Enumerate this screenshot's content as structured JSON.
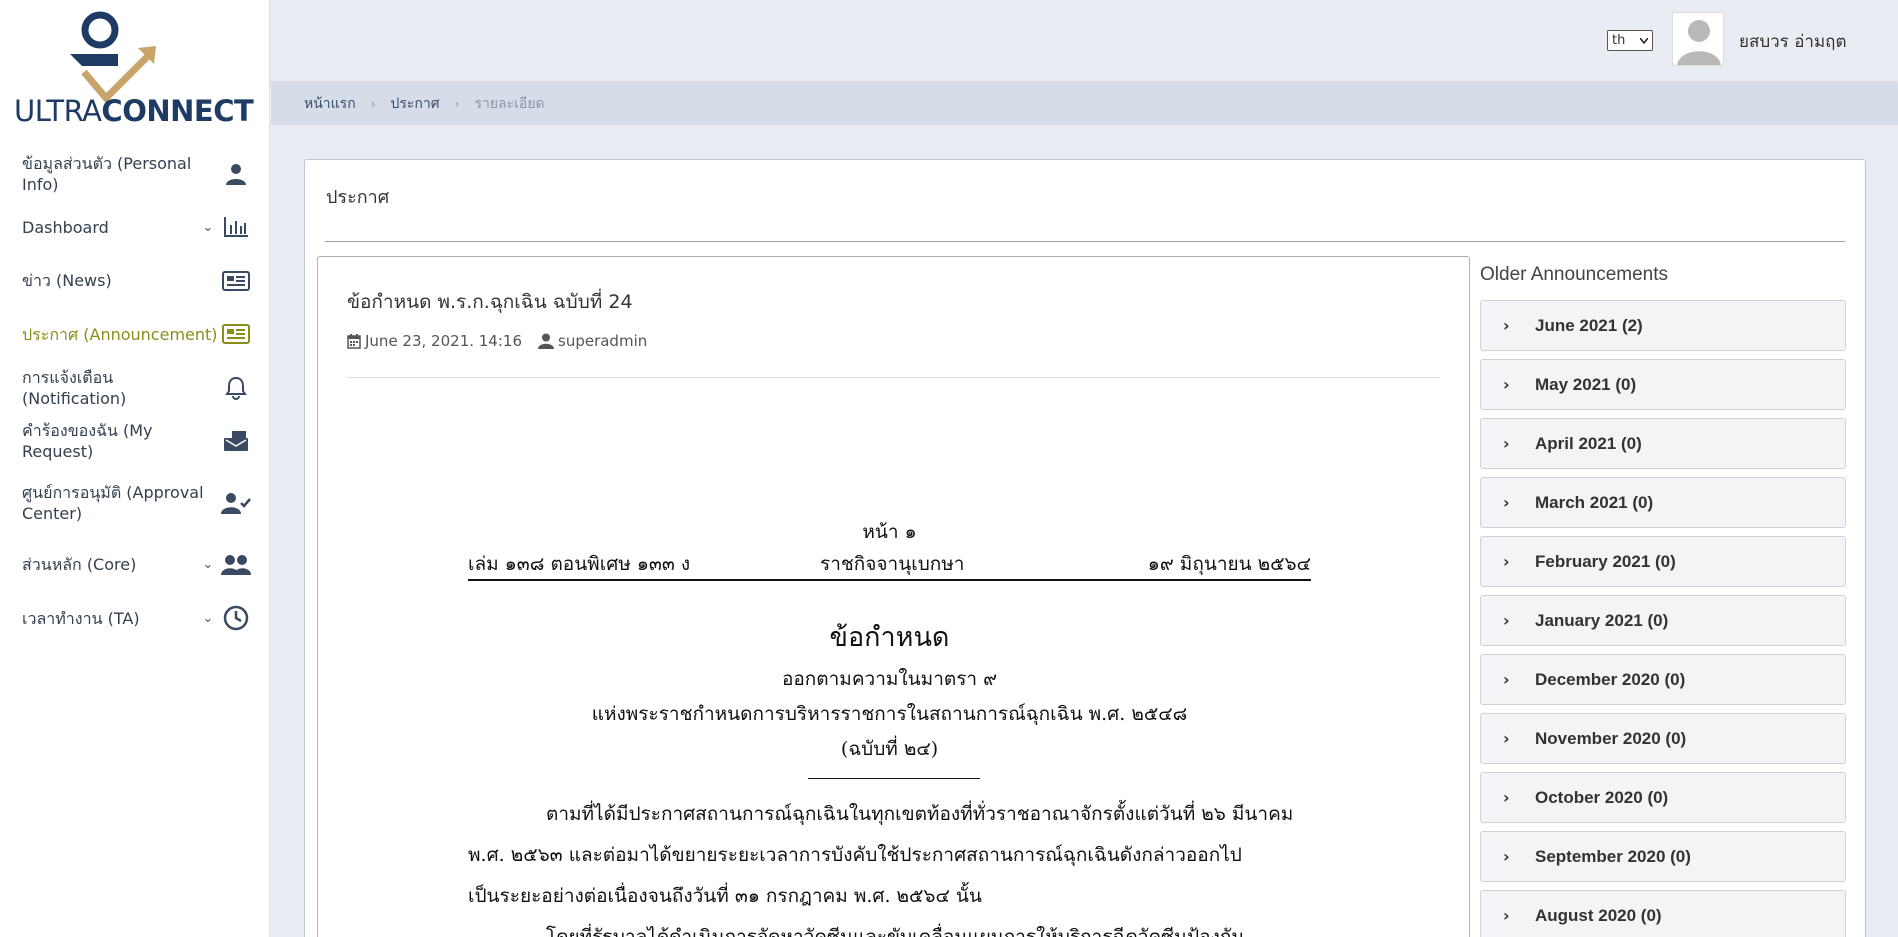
{
  "logo": {
    "word1": "ULTRA",
    "word2": "CONNECT",
    "colors": {
      "navy": "#1d3b64",
      "gold": "#c9a46a"
    }
  },
  "sidebar": {
    "items": [
      {
        "label": "ข้อมูลส่วนตัว (Personal Info)",
        "icon": "user-icon",
        "chevron": false,
        "active": false
      },
      {
        "label": "Dashboard",
        "icon": "chart-icon",
        "chevron": true,
        "active": false
      },
      {
        "label": "ข่าว (News)",
        "icon": "newspaper-icon",
        "chevron": false,
        "active": false
      },
      {
        "label": "ประกาศ (Announcement)",
        "icon": "newspaper-icon",
        "chevron": false,
        "active": true
      },
      {
        "label": "การแจ้งเตือน (Notification)",
        "icon": "bell-icon",
        "chevron": false,
        "active": false
      },
      {
        "label": "คำร้องของฉัน (My Request)",
        "icon": "mailbox-icon",
        "chevron": false,
        "active": false
      },
      {
        "label": "ศูนย์การอนุมัติ (Approval Center)",
        "icon": "user-check-icon",
        "chevron": false,
        "active": false
      },
      {
        "label": "ส่วนหลัก (Core)",
        "icon": "users-icon",
        "chevron": true,
        "active": false
      },
      {
        "label": "เวลาทำงาน (TA)",
        "icon": "clock-icon",
        "chevron": true,
        "active": false
      }
    ]
  },
  "header": {
    "language": "th",
    "username": "ยสบวร อ่ามฤต"
  },
  "breadcrumb": {
    "home": "หน้าแรก",
    "section": "ประกาศ",
    "current": "รายละเอียด"
  },
  "main": {
    "card_title": "ประกาศ",
    "post": {
      "title": "ข้อกำหนด พ.ร.ก.ฉุกเฉิน ฉบับที่ 24",
      "date": "June 23, 2021. 14:16",
      "author": "superadmin"
    },
    "document": {
      "page_no": "หน้า   ๑",
      "volume": "เล่ม   ๑๓๘   ตอนพิเศษ   ๑๓๓   ง",
      "gazette": "ราชกิจจานุเบกษา",
      "date": "๑๙   มิถุนายน   ๒๕๖๔",
      "heading": "ข้อกำหนด",
      "sub1": "ออกตามความในมาตรา  ๙",
      "sub2": "แห่งพระราชกำหนดการบริหารราชการในสถานการณ์ฉุกเฉิน  พ.ศ.  ๒๕๔๘",
      "sub3": "(ฉบับที่  ๒๔)",
      "para_line1": "ตามที่ได้มีประกาศสถานการณ์ฉุกเฉินในทุกเขตท้องที่ทั่วราชอาณาจักรตั้งแต่วันที่  ๒๖  มีนาคม",
      "para_line2": "พ.ศ.  ๒๕๖๓  และต่อมาได้ขยายระยะเวลาการบังคับใช้ประกาศสถานการณ์ฉุกเฉินดังกล่าวออกไป",
      "para_line3": "เป็นระยะอย่างต่อเนื่องจนถึงวันที่  ๓๑  กรกฎาคม  พ.ศ.  ๒๕๖๔  นั้น",
      "para_line4": "โดยที่รัฐบาลได้ดำเนินการจัดหาวัคซีนและขับเคลื่อนแผนการให้บริการฉีดวัคซีนป้องกัน"
    },
    "older": {
      "title": "Older Announcements",
      "items": [
        "June 2021 (2)",
        "May 2021 (0)",
        "April 2021 (0)",
        "March 2021 (0)",
        "February 2021 (0)",
        "January 2021 (0)",
        "December 2020 (0)",
        "November 2020 (0)",
        "October 2020 (0)",
        "September 2020 (0)",
        "August 2020 (0)"
      ]
    }
  }
}
